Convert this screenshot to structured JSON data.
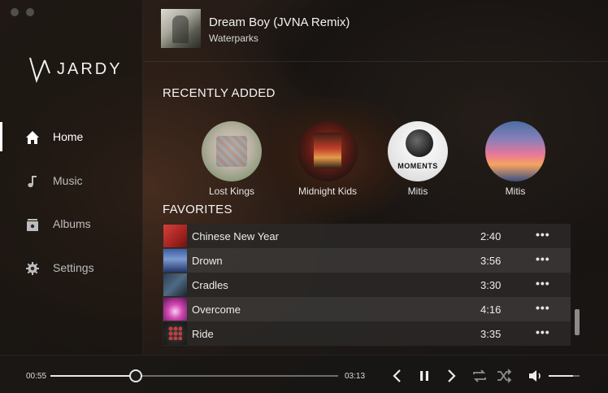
{
  "now_playing": {
    "title": "Dream Boy (JVNA Remix)",
    "artist": "Waterparks"
  },
  "logo": {
    "text": "JARDY"
  },
  "sidebar": {
    "items": [
      {
        "label": "Home",
        "icon": "home-icon",
        "active": true
      },
      {
        "label": "Music",
        "icon": "music-note-icon",
        "active": false
      },
      {
        "label": "Albums",
        "icon": "album-icon",
        "active": false
      },
      {
        "label": "Settings",
        "icon": "gear-icon",
        "active": false
      }
    ]
  },
  "recently_added": {
    "title": "RECENTLY ADDED",
    "albums": [
      {
        "name": "Lost Kings"
      },
      {
        "name": "Midnight Kids"
      },
      {
        "name": "Mitis"
      },
      {
        "name": "Mitis"
      }
    ]
  },
  "favorites": {
    "title": "FAVORITES",
    "tracks": [
      {
        "title": "Chinese New Year",
        "duration": "2:40",
        "more": "•••"
      },
      {
        "title": "Drown",
        "duration": "3:56",
        "more": "•••"
      },
      {
        "title": "Cradles",
        "duration": "3:30",
        "more": "•••"
      },
      {
        "title": "Overcome",
        "duration": "4:16",
        "more": "•••"
      },
      {
        "title": "Ride",
        "duration": "3:35",
        "more": "•••"
      }
    ]
  },
  "player": {
    "current_time": "00:55",
    "total_time": "03:13",
    "progress": 0.297,
    "volume": 0.8,
    "playing": true
  },
  "colors": {
    "accent": "#ffffff",
    "row_odd": "#2a2827",
    "row_even": "#3a3837"
  }
}
